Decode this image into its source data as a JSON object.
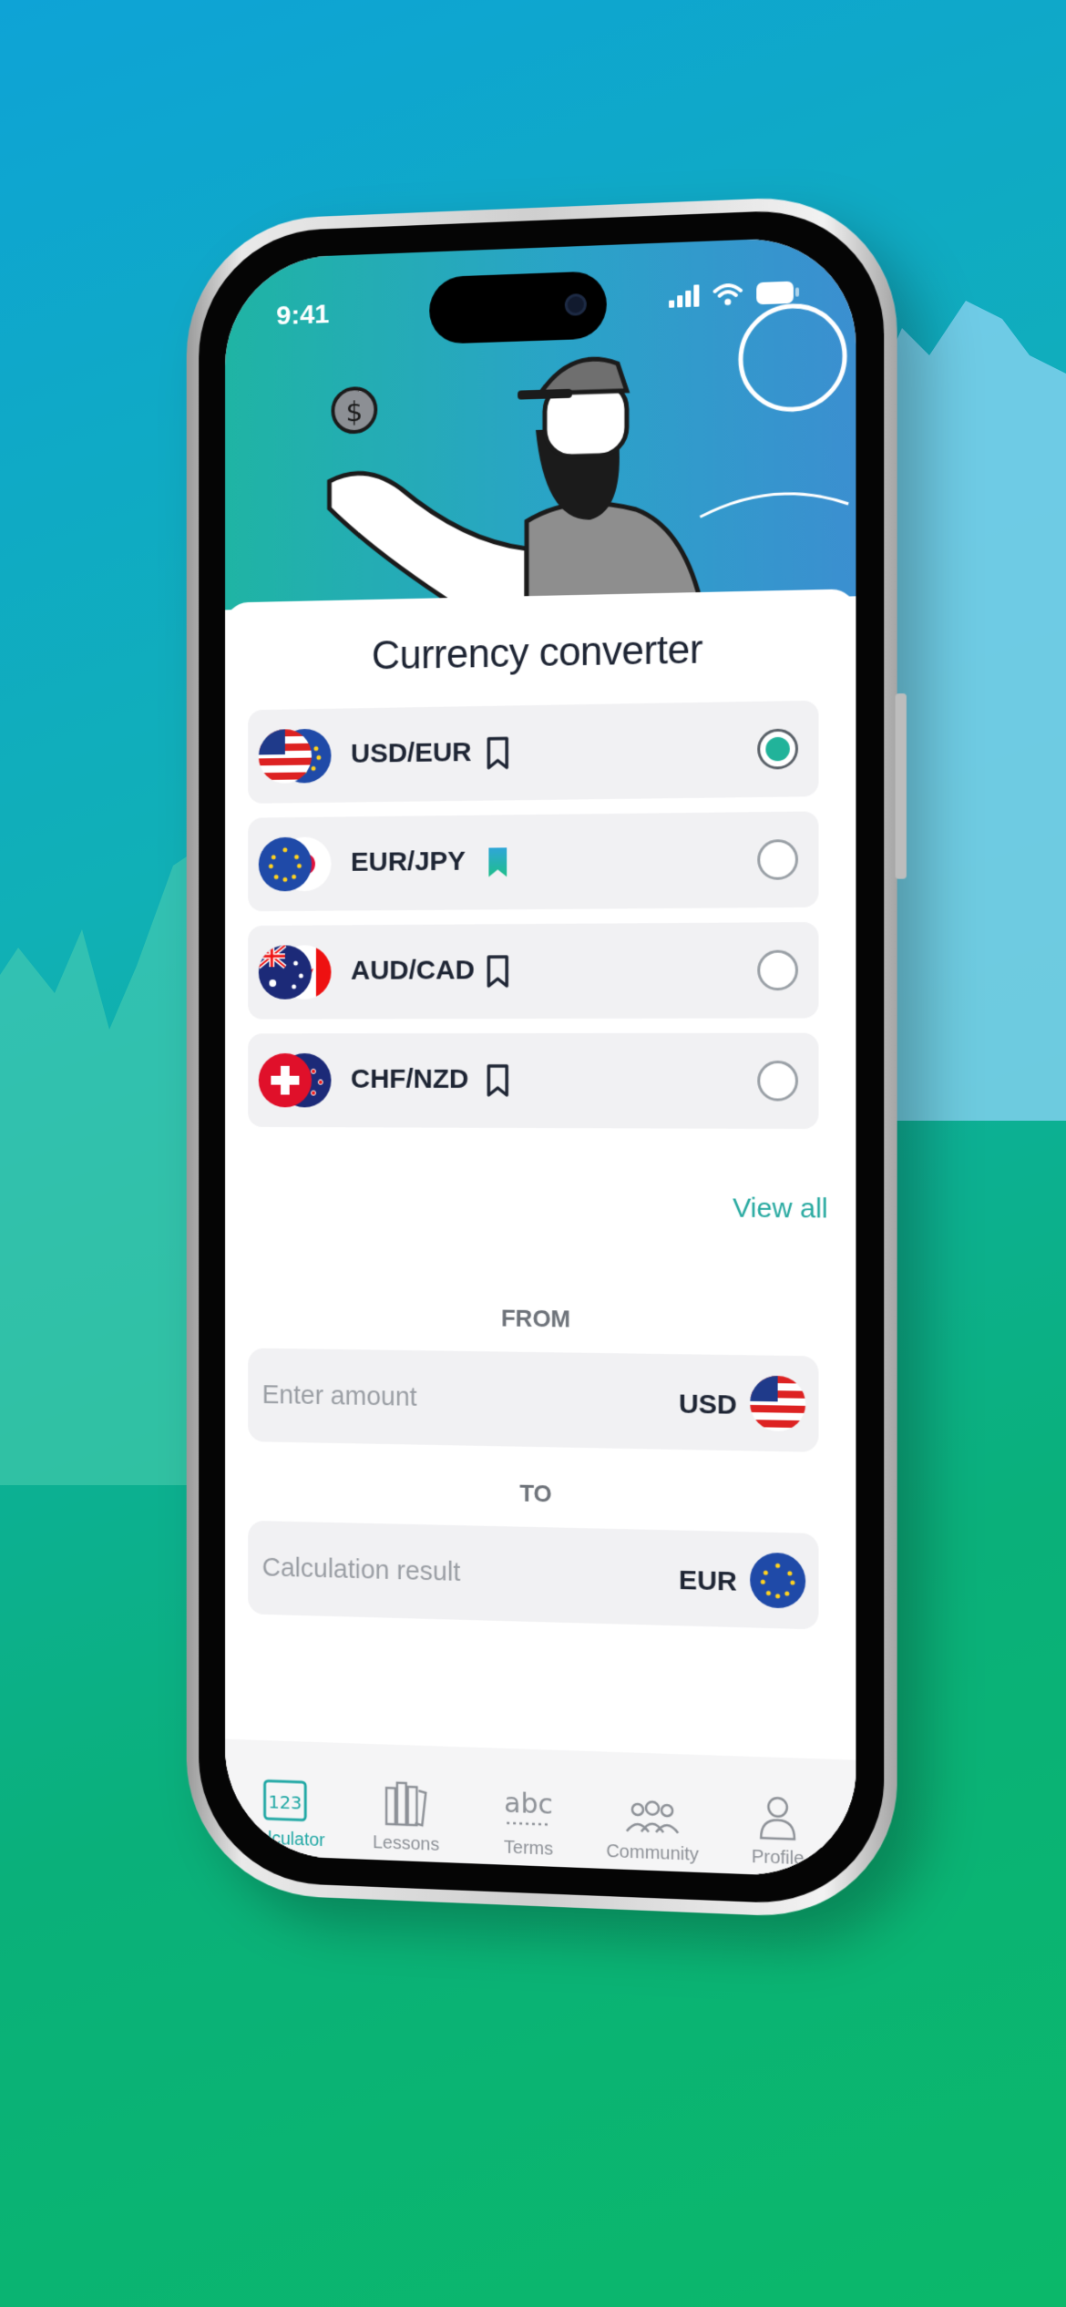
{
  "status": {
    "time": "9:41"
  },
  "screen": {
    "title": "Currency converter"
  },
  "pairs": [
    {
      "label": "USD/EUR",
      "bookmarked": false,
      "selected": true
    },
    {
      "label": "EUR/JPY",
      "bookmarked": true,
      "selected": false
    },
    {
      "label": "AUD/CAD",
      "bookmarked": false,
      "selected": false
    },
    {
      "label": "CHF/NZD",
      "bookmarked": false,
      "selected": false
    }
  ],
  "view_all": "View all",
  "from": {
    "label": "FROM",
    "placeholder": "Enter amount",
    "currency": "USD"
  },
  "to": {
    "label": "TO",
    "placeholder": "Calculation result",
    "currency": "EUR"
  },
  "tabs": [
    {
      "label": "Calculator",
      "icon": "calculator-icon",
      "active": true
    },
    {
      "label": "Lessons",
      "icon": "books-icon",
      "active": false
    },
    {
      "label": "Terms",
      "icon": "abc-icon",
      "active": false
    },
    {
      "label": "Community",
      "icon": "community-icon",
      "active": false
    },
    {
      "label": "Profile",
      "icon": "profile-icon",
      "active": false
    }
  ],
  "colors": {
    "accent": "#21b39a",
    "link": "#27a9a0",
    "text": "#1e2534"
  }
}
